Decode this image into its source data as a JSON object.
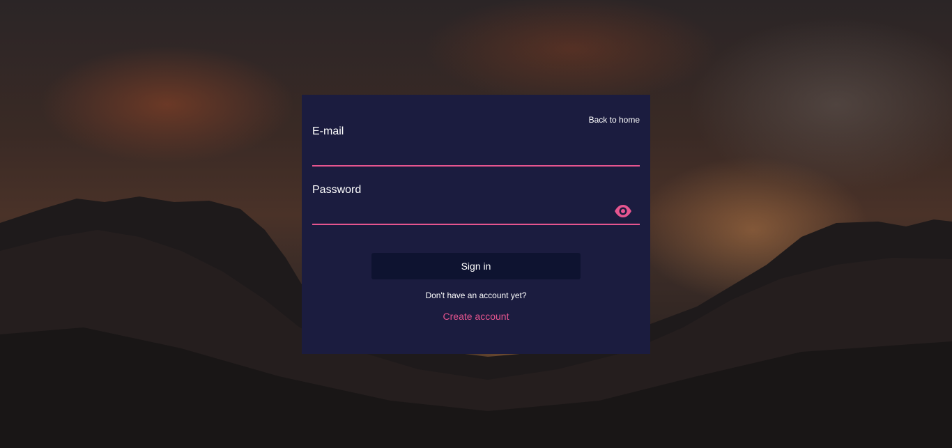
{
  "page": {
    "background": "dark mountain landscape at sunset",
    "card_color": "#1b1c3f",
    "accent_color": "#e6558f"
  },
  "login": {
    "back_link": "Back to home",
    "email_label": "E-mail",
    "email_value": "",
    "password_label": "Password",
    "password_value": "",
    "password_toggle_icon": "eye-icon",
    "signin_label": "Sign in",
    "no_account_text": "Don't have an account yet?",
    "create_account_label": "Create account"
  }
}
